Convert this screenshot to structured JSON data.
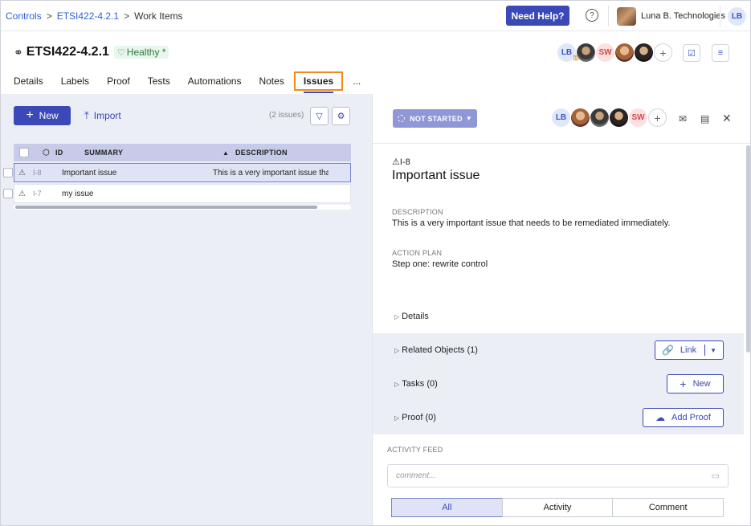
{
  "breadcrumb": {
    "items": [
      "Controls",
      "ETSI422-4.2.1",
      "Work Items"
    ],
    "separator": ">"
  },
  "header": {
    "help_label": "Need Help?",
    "org_name": "Luna B. Technologies",
    "user_initials": "LB"
  },
  "control": {
    "title": "ETSI422-4.2.1",
    "health": "Healthy *",
    "assignees": [
      "LB",
      "SW"
    ]
  },
  "tabs": [
    {
      "label": "Details"
    },
    {
      "label": "Labels"
    },
    {
      "label": "Proof"
    },
    {
      "label": "Tests"
    },
    {
      "label": "Automations"
    },
    {
      "label": "Notes"
    },
    {
      "label": "Issues",
      "active": true
    },
    {
      "label": "..."
    }
  ],
  "list": {
    "new_label": "New",
    "import_label": "Import",
    "count_label": "(2 issues)",
    "columns": {
      "id": "ID",
      "summary": "SUMMARY",
      "description": "DESCRIPTION"
    },
    "rows": [
      {
        "id": "I-8",
        "summary": "Important issue",
        "description": "This is a very important issue that",
        "selected": true
      },
      {
        "id": "I-7",
        "summary": "my issue",
        "description": "",
        "selected": false
      }
    ]
  },
  "detail": {
    "status": "NOT STARTED",
    "assignees": [
      "LB",
      "SW"
    ],
    "issue_id": "I-8",
    "title": "Important issue",
    "description_label": "DESCRIPTION",
    "description": "This is a very important issue that needs to be remediated immediately.",
    "action_plan_label": "ACTION PLAN",
    "action_plan": "Step one: rewrite control",
    "sections": [
      {
        "label": "Details"
      },
      {
        "label": "Related Objects (1)",
        "button": "Link"
      },
      {
        "label": "Tasks (0)",
        "button": "New"
      },
      {
        "label": "Proof (0)",
        "button": "Add Proof"
      }
    ],
    "activity_label": "ACTIVITY FEED",
    "comment_placeholder": "comment...",
    "filters": [
      "All",
      "Activity",
      "Comment"
    ],
    "active_filter": "All"
  },
  "colors": {
    "primary": "#3a48b8",
    "tab_highlight": "#f08c1b",
    "health_green": "#2a7a3c",
    "status_bg": "#8f97d6"
  },
  "icons": [
    "control-icon",
    "heart-pulse-icon",
    "question-icon",
    "calendar-check-icon",
    "rss-icon",
    "filter-icon",
    "gear-icon",
    "warning-icon",
    "comment-icon",
    "archive-icon",
    "close-icon",
    "link-icon",
    "cloud-upload-icon"
  ]
}
